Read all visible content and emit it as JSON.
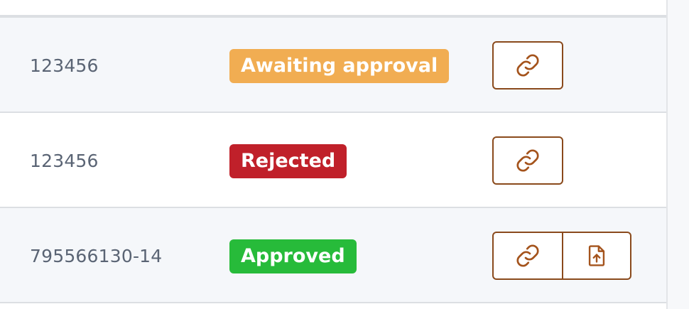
{
  "colors": {
    "awaiting": "#f1ad52",
    "rejected": "#c0202a",
    "approved": "#27bb3a",
    "button_border": "#8a4a1c",
    "icon": "#a4531c",
    "row_alt": "#f5f7fa",
    "text_muted": "#5a6474"
  },
  "rows": [
    {
      "order_id": "123456",
      "status": "Awaiting approval",
      "status_color": "#f1ad52",
      "actions": [
        "link-icon"
      ]
    },
    {
      "order_id": "123456",
      "status": "Rejected",
      "status_color": "#c0202a",
      "actions": [
        "link-icon"
      ]
    },
    {
      "order_id": "795566130-14",
      "status": "Approved",
      "status_color": "#27bb3a",
      "actions": [
        "link-icon",
        "file-upload-icon"
      ]
    }
  ]
}
